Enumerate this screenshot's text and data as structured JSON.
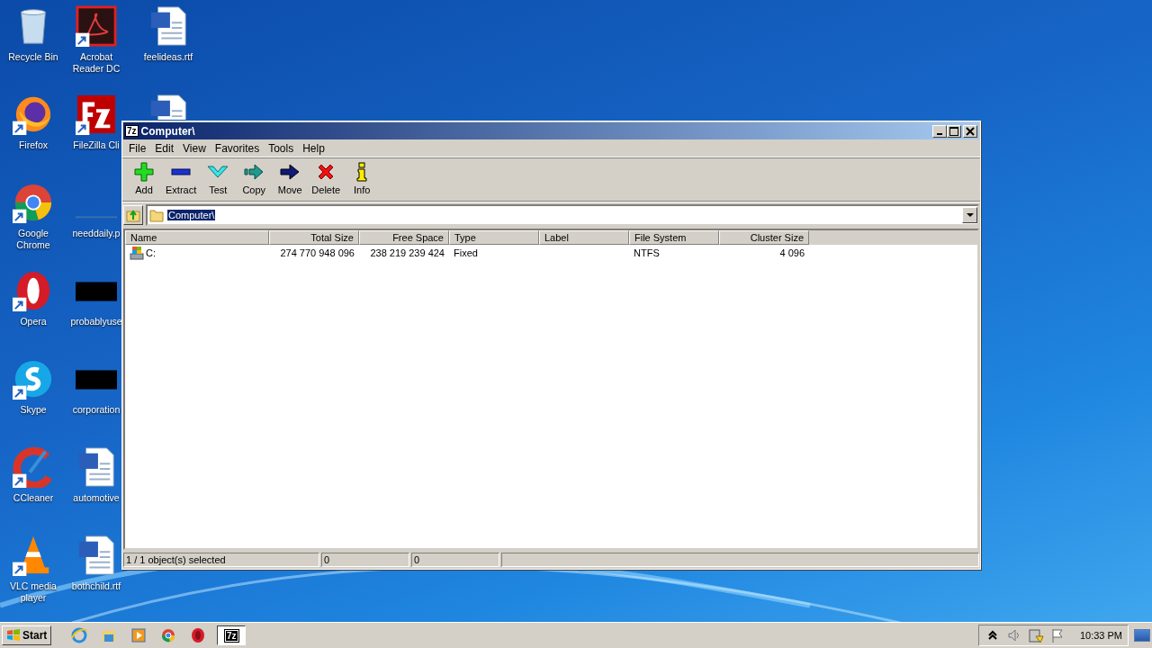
{
  "desktop_columns": [
    {
      "icons": [
        {
          "label": "Recycle Bin",
          "kind": "recycle",
          "shortcut": false
        },
        {
          "label": "Firefox",
          "kind": "firefox",
          "shortcut": true
        },
        {
          "label": "Google Chrome",
          "kind": "chrome",
          "shortcut": true
        },
        {
          "label": "Opera",
          "kind": "opera",
          "shortcut": true
        },
        {
          "label": "Skype",
          "kind": "skype",
          "shortcut": true
        },
        {
          "label": "CCleaner",
          "kind": "ccleaner",
          "shortcut": true
        },
        {
          "label": "VLC media player",
          "kind": "vlc",
          "shortcut": true
        }
      ]
    },
    {
      "icons": [
        {
          "label": "Acrobat Reader DC",
          "kind": "acrobat",
          "shortcut": true
        },
        {
          "label": "FileZilla Cli",
          "kind": "filezilla",
          "shortcut": true
        },
        {
          "label": "needdaily.p",
          "kind": "line",
          "shortcut": false
        },
        {
          "label": "probablyuse",
          "kind": "bar",
          "shortcut": false
        },
        {
          "label": "corporation",
          "kind": "bar",
          "shortcut": false
        },
        {
          "label": "automotive",
          "kind": "word",
          "shortcut": false
        },
        {
          "label": "bothchild.rtf",
          "kind": "word",
          "shortcut": false
        }
      ]
    },
    {
      "icons": [
        {
          "label": "feelideas.rtf",
          "kind": "word",
          "shortcut": false
        },
        {
          "kind": "word"
        }
      ]
    }
  ],
  "window": {
    "badge": "7z",
    "title": "Computer\\",
    "menu": [
      "File",
      "Edit",
      "View",
      "Favorites",
      "Tools",
      "Help"
    ],
    "toolbar": [
      {
        "label": "Add",
        "kind": "add"
      },
      {
        "label": "Extract",
        "kind": "extract"
      },
      {
        "label": "Test",
        "kind": "test"
      },
      {
        "label": "Copy",
        "kind": "copy"
      },
      {
        "label": "Move",
        "kind": "move"
      },
      {
        "label": "Delete",
        "kind": "delete"
      },
      {
        "label": "Info",
        "kind": "info"
      }
    ],
    "address": "Computer\\",
    "columns": [
      "Name",
      "Total Size",
      "Free Space",
      "Type",
      "Label",
      "File System",
      "Cluster Size"
    ],
    "rows": [
      {
        "cells": [
          "C:",
          "274 770 948 096",
          "238 219 239 424",
          "Fixed",
          null,
          "NTFS",
          "4 096"
        ]
      }
    ],
    "status": [
      "1 / 1 object(s) selected",
      "0",
      "0"
    ]
  },
  "taskbar": {
    "start": "Start",
    "quick_launch": [
      {
        "kind": "ie"
      },
      {
        "kind": "explorer"
      },
      {
        "kind": "media"
      },
      {
        "kind": "chrome"
      },
      {
        "kind": "opera"
      }
    ],
    "tasks": [
      {
        "label": "7z",
        "selected": true
      }
    ],
    "tray": [
      {
        "kind": "chevron"
      },
      {
        "kind": "speaker"
      },
      {
        "kind": "network"
      },
      {
        "kind": "flag"
      }
    ],
    "clock": "10:33 PM"
  }
}
